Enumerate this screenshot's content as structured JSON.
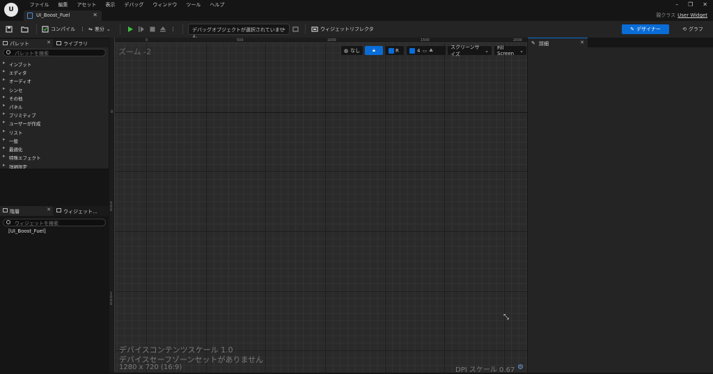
{
  "app": {
    "logo_text": "U",
    "menu": [
      "ファイル",
      "編集",
      "アセット",
      "表示",
      "デバッグ",
      "ウィンドウ",
      "ツール",
      "ヘルプ"
    ],
    "doc_tab": "UI_Boost_Fuel",
    "parent_class_label": "親クラス",
    "parent_class_value": "User Widget",
    "win_min": "–",
    "win_max": "❐",
    "win_close": "✕"
  },
  "toolbar": {
    "compile": "コンパイル",
    "diff": "差分",
    "debug_select": "デバッグオブジェクトが選択されていません",
    "widget_reflector": "ウィジェットリフレクタ",
    "designer": "デザイナー",
    "graph": "グラフ"
  },
  "palette": {
    "tab": "パレット",
    "library_tab": "ライブラリ",
    "search_placeholder": "パレットを検索",
    "categories": [
      "インプット",
      "エディタ",
      "オーディオ",
      "シンセ",
      "その他",
      "パネル",
      "プリミティブ",
      "ユーザーが作成",
      "リスト",
      "一般",
      "最適化",
      "特殊エフェクト",
      "詳細設定"
    ]
  },
  "hierarchy": {
    "tab": "階層",
    "widget_tab": "ウィジェット...",
    "search_placeholder": "ウィジェットを検索",
    "root": "[UI_Boost_Fuel]"
  },
  "canvas": {
    "zoom": "ズーム -2",
    "ruler_top": [
      "0",
      "500",
      "1000",
      "1500",
      "2000"
    ],
    "ruler_left": [
      "0",
      "500",
      "1000"
    ],
    "btn_none": "なし",
    "btn_r": "R",
    "grid_count": "4",
    "screen_size": "スクリーンサイズ",
    "fill_screen": "Fill Screen",
    "info_scale": "デバイスコンテンツスケール 1.0",
    "info_safezone": "デバイスセーフゾーンセットがありません",
    "info_resolution": "1280 x 720 (16:9)",
    "dpi": "DPI スケール 0.67"
  },
  "details": {
    "tab": "詳細"
  }
}
